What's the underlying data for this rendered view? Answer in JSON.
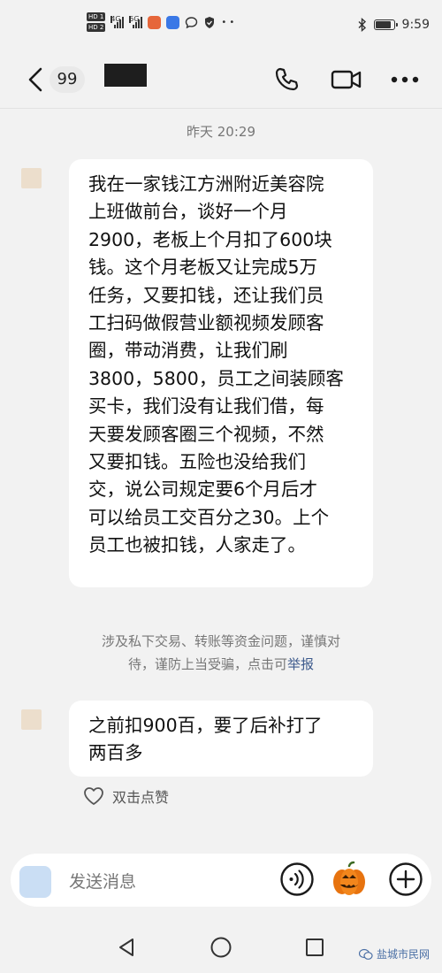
{
  "status_bar": {
    "time": "9:59",
    "network_1": "4G",
    "network_2": "5G",
    "hd_1": "HD 1",
    "hd_2": "HD 2"
  },
  "header": {
    "unread_count": "99",
    "icons": [
      "back-arrow-icon",
      "phone-icon",
      "video-call-icon",
      "more-icon"
    ]
  },
  "chat": {
    "timestamp": "昨天 20:29",
    "messages": [
      {
        "text": "我在一家钱江方洲附近美容院\n上班做前台，谈好一个月\n2900，老板上个月扣了600块\n钱。这个月老板又让完成5万\n任务，又要扣钱，还让我们员\n工扫码做假营业额视频发顾客\n圈，带动消费，让我们刷\n3800，5800，员工之间装顾客\n买卡，我们没有让我们借，每\n天要发顾客圈三个视频，不然\n又要扣钱。五险也没给我们\n交，说公司规定要6个月后才\n可以给员工交百分之30。上个\n员工也被扣钱，人家走了。"
      },
      {
        "text": "之前扣900百，要了后补打了\n两百多"
      }
    ],
    "warning_line_1": "涉及私下交易、转账等资金问题，谨慎对",
    "warning_line_2": "待，谨防上当受骗，点击可",
    "warning_link": "举报",
    "like_label": "双击点赞"
  },
  "input": {
    "placeholder": "发送消息"
  },
  "watermark": "盐城市民网"
}
